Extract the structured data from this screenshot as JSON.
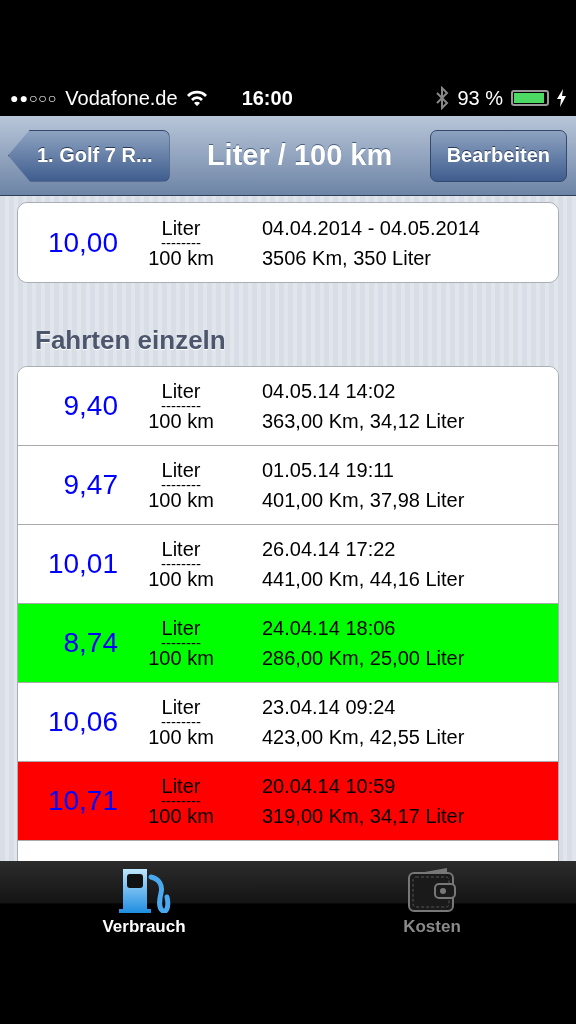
{
  "status_bar": {
    "signal": "●●○○○",
    "carrier": "Vodafone.de",
    "time": "16:00",
    "battery": "93 %"
  },
  "nav": {
    "back": "1. Golf 7 R...",
    "title": "Liter / 100 km",
    "edit": "Bearbeiten"
  },
  "summary": {
    "value": "10,00",
    "unit_top": "Liter",
    "unit_line": "--------",
    "unit_bottom": "100 km",
    "period": "04.04.2014 - 04.05.2014",
    "totals": "3506 Km, 350 Liter"
  },
  "section_title": "Fahrten einzeln",
  "trips": [
    {
      "value": "9,40",
      "unit_top": "Liter",
      "unit_line": "--------",
      "unit_bottom": "100 km",
      "date": "04.05.14 14:02",
      "details": "363,00 Km, 34,12 Liter",
      "color": "#ffffff"
    },
    {
      "value": "9,47",
      "unit_top": "Liter",
      "unit_line": "--------",
      "unit_bottom": "100 km",
      "date": "01.05.14 19:11",
      "details": "401,00 Km, 37,98 Liter",
      "color": "#ffffff"
    },
    {
      "value": "10,01",
      "unit_top": "Liter",
      "unit_line": "--------",
      "unit_bottom": "100 km",
      "date": "26.04.14 17:22",
      "details": "441,00 Km, 44,16 Liter",
      "color": "#ffffff"
    },
    {
      "value": "8,74",
      "unit_top": "Liter",
      "unit_line": "--------",
      "unit_bottom": "100 km",
      "date": "24.04.14 18:06",
      "details": "286,00 Km, 25,00 Liter",
      "color": "#00ff00"
    },
    {
      "value": "10,06",
      "unit_top": "Liter",
      "unit_line": "--------",
      "unit_bottom": "100 km",
      "date": "23.04.14 09:24",
      "details": "423,00 Km, 42,55 Liter",
      "color": "#ffffff"
    },
    {
      "value": "10,71",
      "unit_top": "Liter",
      "unit_line": "--------",
      "unit_bottom": "100 km",
      "date": "20.04.14 10:59",
      "details": "319,00 Km, 34,17 Liter",
      "color": "#ff0000"
    }
  ],
  "tabs": [
    {
      "label": "Verbrauch",
      "selected": true
    },
    {
      "label": "Kosten",
      "selected": false
    }
  ]
}
